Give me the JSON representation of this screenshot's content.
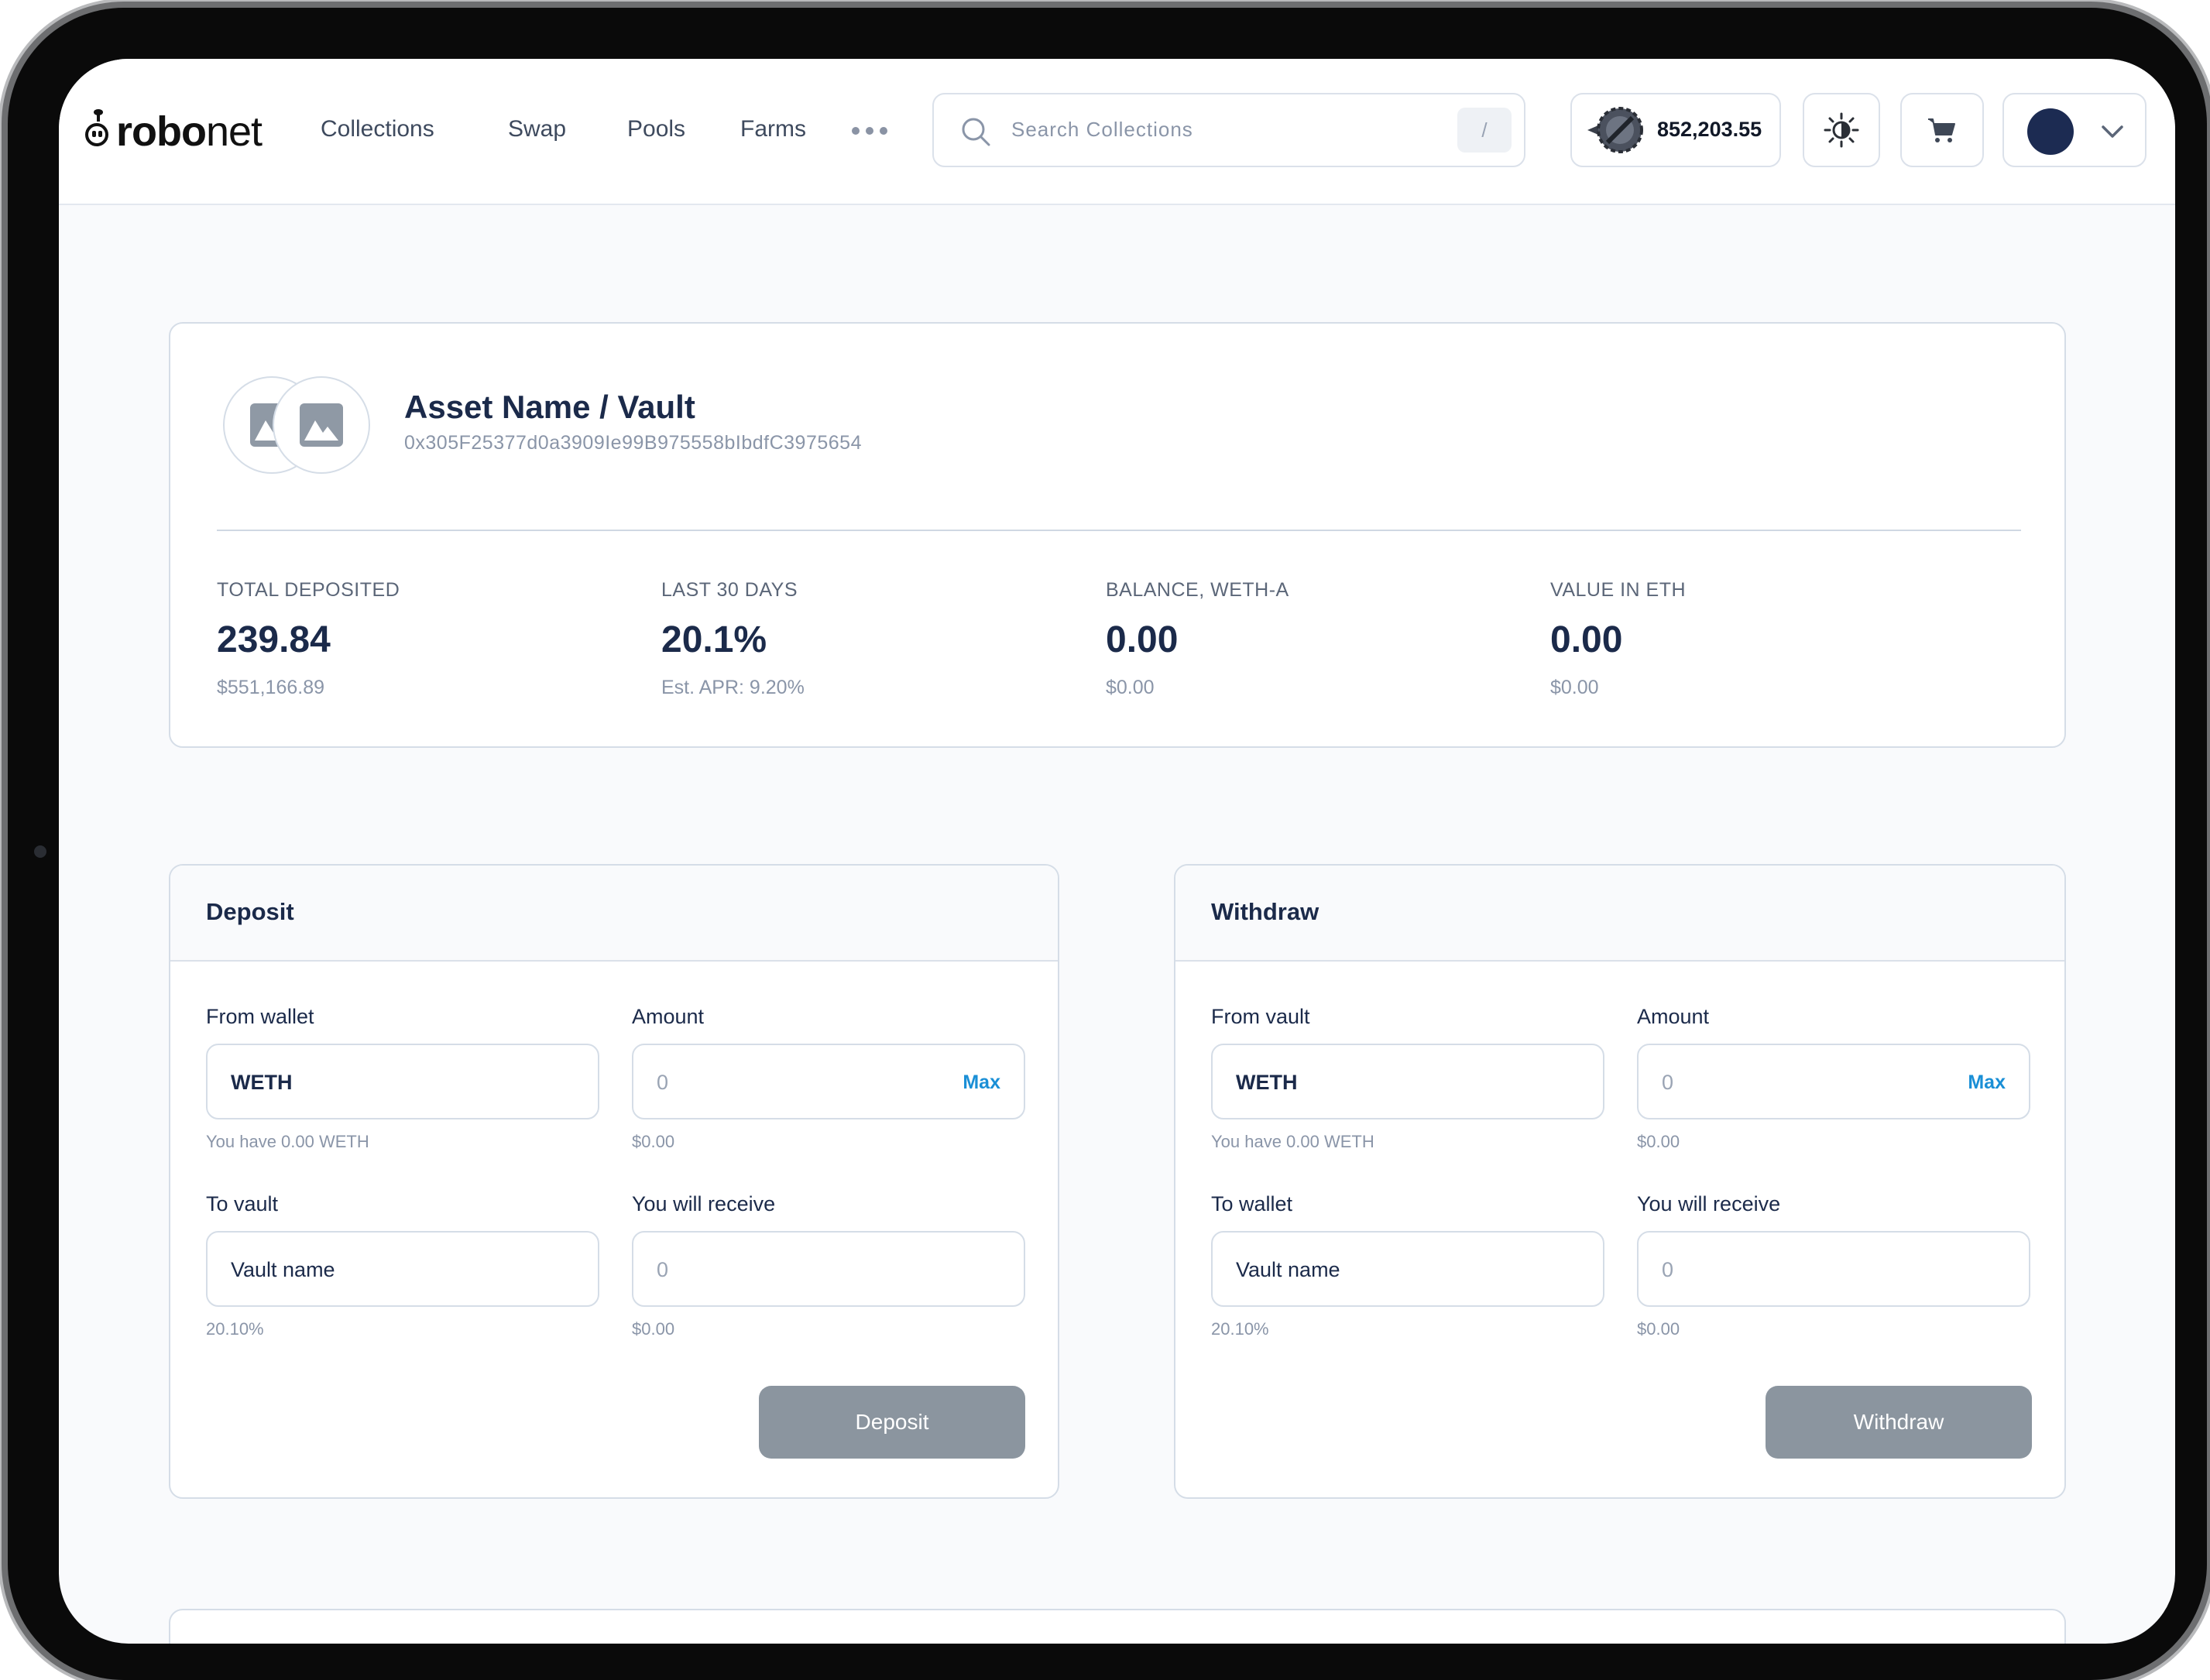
{
  "brand": {
    "logo_bold": "robo",
    "logo_light": "net"
  },
  "nav": {
    "links": [
      "Collections",
      "Swap",
      "Pools",
      "Farms"
    ],
    "more_icon": "ellipsis-icon"
  },
  "search": {
    "placeholder": "Search Collections",
    "shortcut": "/"
  },
  "wallet": {
    "balance": "852,203.55"
  },
  "icons": {
    "theme": "sun-icon",
    "cart": "cart-icon",
    "profile": "avatar",
    "dropdown": "chevron-down-icon"
  },
  "asset": {
    "title": "Asset Name / Vault",
    "address": "0x305F25377d0a3909Ie99B975558bIbdfC3975654",
    "stats": [
      {
        "label": "TOTAL DEPOSITED",
        "value": "239.84",
        "sub": "$551,166.89"
      },
      {
        "label": "LAST 30 DAYS",
        "value": "20.1%",
        "sub": "Est. APR: 9.20%"
      },
      {
        "label": "BALANCE, WETH-A",
        "value": "0.00",
        "sub": "$0.00"
      },
      {
        "label": "VALUE IN ETH",
        "value": "0.00",
        "sub": "$0.00"
      }
    ]
  },
  "deposit": {
    "title": "Deposit",
    "from_label": "From wallet",
    "from_value": "WETH",
    "from_hint": "You have 0.00 WETH",
    "amount_label": "Amount",
    "amount_value": "0",
    "amount_max": "Max",
    "amount_hint": "$0.00",
    "to_label": "To vault",
    "to_value": "Vault name",
    "to_hint": "20.10%",
    "receive_label": "You will receive",
    "receive_value": "0",
    "receive_hint": "$0.00",
    "button": "Deposit"
  },
  "withdraw": {
    "title": "Withdraw",
    "from_label": "From vault",
    "from_value": "WETH",
    "from_hint": "You have 0.00 WETH",
    "amount_label": "Amount",
    "amount_value": "0",
    "amount_max": "Max",
    "amount_hint": "$0.00",
    "to_label": "To wallet",
    "to_value": "Vault name",
    "to_hint": "20.10%",
    "receive_label": "You will receive",
    "receive_value": "0",
    "receive_hint": "$0.00",
    "button": "Withdraw"
  },
  "colors": {
    "primary_text": "#1b2a4a",
    "accent": "#1a8fd6",
    "button_disabled": "#8b959f",
    "avatar": "#1c2b52"
  }
}
